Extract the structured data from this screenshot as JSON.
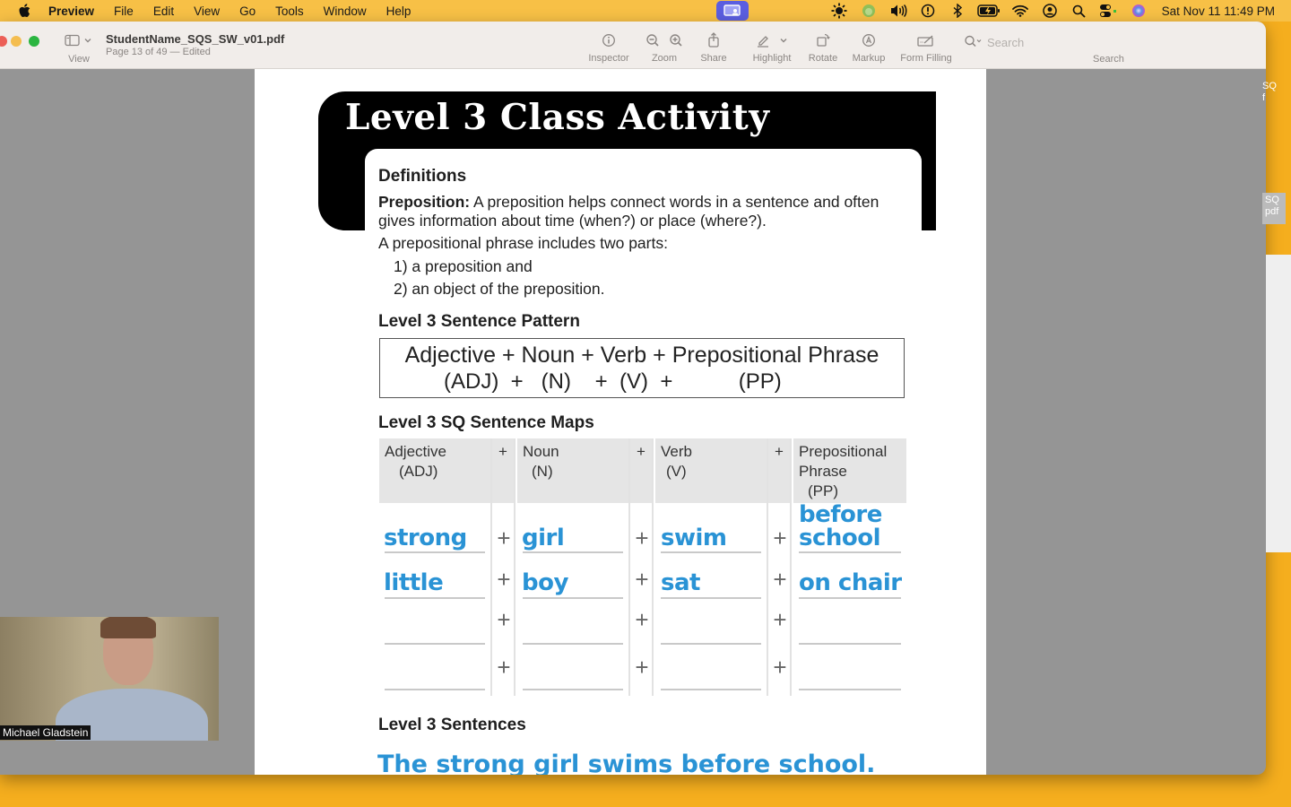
{
  "menubar": {
    "app": "Preview",
    "items": [
      "File",
      "Edit",
      "View",
      "Go",
      "Tools",
      "Window",
      "Help"
    ],
    "status_icons": [
      "brightness-icon",
      "app-status-icon",
      "volume-icon",
      "time-machine-icon",
      "bluetooth-icon",
      "battery-icon",
      "wifi-icon",
      "user-account-icon",
      "spotlight-search-icon",
      "control-center-icon",
      "siri-icon"
    ],
    "clock": "Sat Nov 11  11:49 PM"
  },
  "toolbar": {
    "view_label": "View",
    "doc_title": "StudentName_SQS_SW_v01.pdf",
    "doc_subtitle": "Page 13 of 49 — Edited",
    "inspector": "Inspector",
    "zoom": "Zoom",
    "share": "Share",
    "highlight": "Highlight",
    "rotate": "Rotate",
    "markup": "Markup",
    "form_filling": "Form Filling",
    "search_placeholder": "Search",
    "search_label": "Search"
  },
  "document": {
    "banner_title": "Level 3 Class Activity",
    "definitions_heading": "Definitions",
    "preposition_term": "Preposition:",
    "preposition_def_1": " A preposition helps connect words in a sentence and often",
    "preposition_def_2": "gives information about time (when?) or place (where?).",
    "phrase_intro": "A prepositional phrase includes two parts:",
    "part_1": "1) a preposition and",
    "part_2": "2) an object of the preposition.",
    "pattern_heading": "Level 3 Sentence Pattern",
    "pattern_line_1": "Adjective + Noun + Verb + Prepositional Phrase",
    "pattern_line_2": "(ADJ)  +   (N)    +  (V)  +           (PP)",
    "maps_heading": "Level 3 SQ Sentence Maps",
    "maps_columns": [
      {
        "label": "Adjective",
        "abbr": "(ADJ)"
      },
      {
        "label": "Noun",
        "abbr": "(N)"
      },
      {
        "label": "Verb",
        "abbr": "(V)"
      },
      {
        "label": "Prepositional Phrase",
        "label_1": "Prepositional",
        "label_2": "Phrase",
        "abbr": "(PP)"
      }
    ],
    "plus": "+",
    "maps_rows": [
      {
        "adj": "strong",
        "noun": "girl",
        "verb": "swim",
        "pp_1": "before",
        "pp_2": "school"
      },
      {
        "adj": "little",
        "noun": "boy",
        "verb": "sat",
        "pp_1": "",
        "pp_2": "on chair"
      },
      {
        "adj": "",
        "noun": "",
        "verb": "",
        "pp_1": "",
        "pp_2": ""
      },
      {
        "adj": "",
        "noun": "",
        "verb": "",
        "pp_1": "",
        "pp_2": ""
      }
    ],
    "sentences_heading": "Level 3 Sentences",
    "sentence_1": "The strong girl swims before school."
  },
  "side_panel": {
    "item_1": "SQ\nf",
    "item_2": "SQ\npdf"
  },
  "video": {
    "participant_name": "Michael Gladstein"
  }
}
